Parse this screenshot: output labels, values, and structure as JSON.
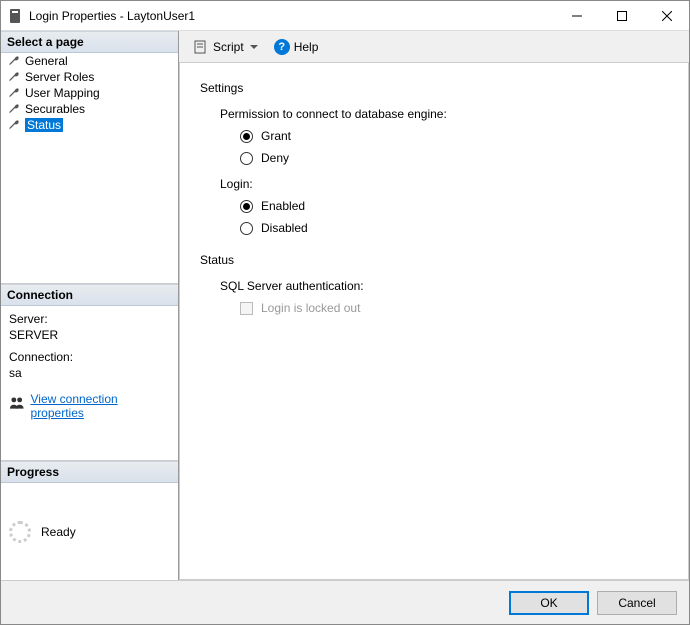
{
  "window": {
    "title": "Login Properties - LaytonUser1"
  },
  "sidebar": {
    "select_page_header": "Select a page",
    "pages": [
      {
        "label": "General"
      },
      {
        "label": "Server Roles"
      },
      {
        "label": "User Mapping"
      },
      {
        "label": "Securables"
      },
      {
        "label": "Status"
      }
    ],
    "connection_header": "Connection",
    "server_label": "Server:",
    "server_value": "SERVER",
    "connection_label": "Connection:",
    "connection_value": "sa",
    "view_props_link": "View connection properties",
    "progress_header": "Progress",
    "progress_status": "Ready"
  },
  "toolbar": {
    "script_label": "Script",
    "help_label": "Help"
  },
  "content": {
    "settings_header": "Settings",
    "permission_label": "Permission to connect to database engine:",
    "grant_label": "Grant",
    "deny_label": "Deny",
    "login_label": "Login:",
    "enabled_label": "Enabled",
    "disabled_label": "Disabled",
    "status_header": "Status",
    "sql_auth_label": "SQL Server authentication:",
    "locked_out_label": "Login is locked out"
  },
  "footer": {
    "ok_label": "OK",
    "cancel_label": "Cancel"
  }
}
